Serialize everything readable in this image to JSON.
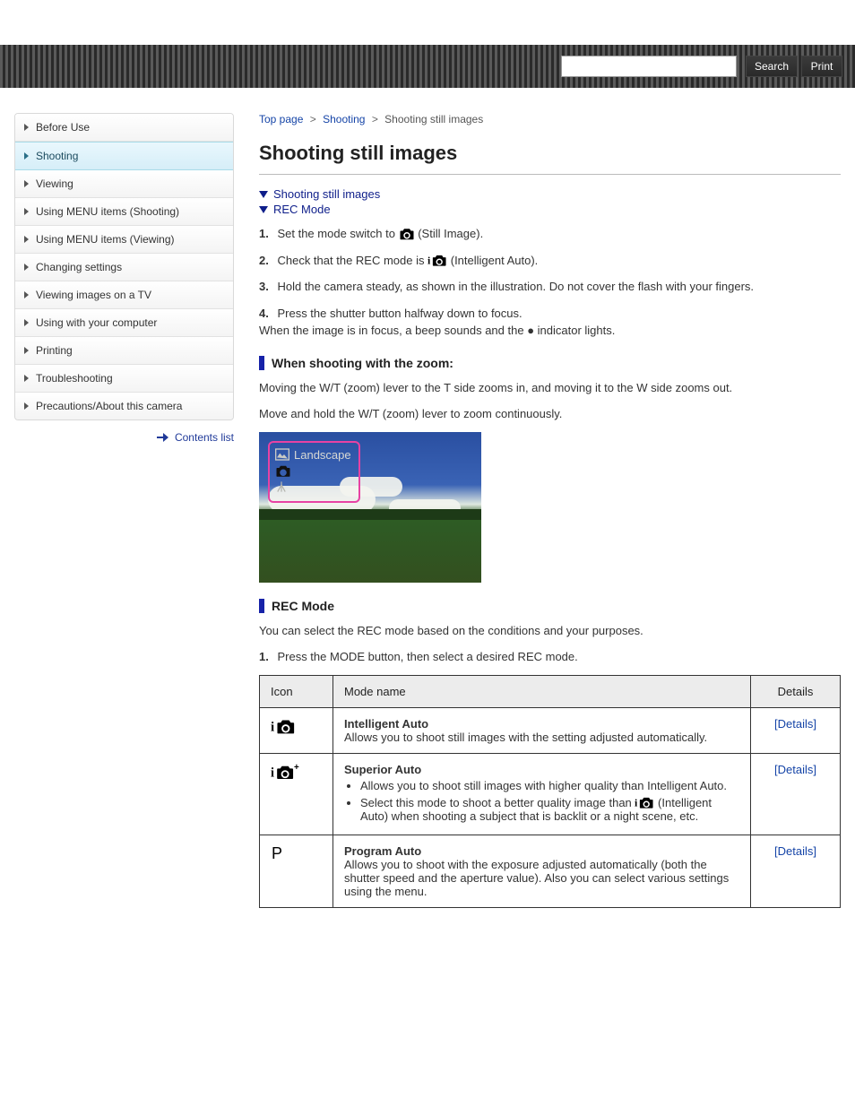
{
  "header": {
    "search_placeholder": "",
    "search_button": "Search",
    "print_button": "Print"
  },
  "sidebar": {
    "items": [
      {
        "label": "Before Use"
      },
      {
        "label": "Shooting"
      },
      {
        "label": "Viewing"
      },
      {
        "label": "Using MENU items (Shooting)"
      },
      {
        "label": "Using MENU items (Viewing)"
      },
      {
        "label": "Changing settings"
      },
      {
        "label": "Viewing images on a TV"
      },
      {
        "label": "Using with your computer"
      },
      {
        "label": "Printing"
      },
      {
        "label": "Troubleshooting"
      },
      {
        "label": "Precautions/About this camera"
      }
    ],
    "active_index": 1,
    "toppage": "Contents list"
  },
  "breadcrumb": {
    "a": "Top page",
    "b": "Shooting",
    "current": "Shooting still images"
  },
  "title": "Shooting still images",
  "disclosures": {
    "d1": "Shooting still images",
    "d2": "REC Mode"
  },
  "block1": {
    "step1_num": "1.",
    "step1_a": "Set the mode switch to ",
    "step1_b": " (Still Image).",
    "step2_num": "2.",
    "step2_a": "Check that the REC mode is ",
    "step2_b": " (Intelligent Auto).",
    "step3_num": "3.",
    "step3": "Hold the camera steady, as shown in the illustration. Do not cover the flash with your fingers.",
    "step4_num": "4.",
    "step4_a": "Press the shutter button halfway down to focus.",
    "step4_b": "When the image is in focus, a beep sounds and the ● indicator lights."
  },
  "overlay_label": "Landscape",
  "section_head1": "When shooting with the zoom:",
  "block2": {
    "p1": "Moving the W/T (zoom) lever to the T side zooms in, and moving it to the W side zooms out.",
    "p2": "Move and hold the W/T (zoom) lever to zoom continuously."
  },
  "section_head2": "REC Mode",
  "rec_mode_intro": "You can select the REC mode based on the conditions and your purposes.",
  "rec_mode_step_num": "1.",
  "rec_mode_step": "Press the MODE button, then select a desired REC mode.",
  "table": {
    "h_icon": "Icon",
    "h_name": "Mode name",
    "h_details": "Details",
    "rows": [
      {
        "mode": "intelligent-auto",
        "name": "Intelligent Auto",
        "desc": "Allows you to shoot still images with the setting adjusted automatically.",
        "details": "[Details]"
      },
      {
        "mode": "superior-auto",
        "name": "Superior Auto",
        "bullets": [
          "Allows you to shoot still images with higher quality than Intelligent Auto.",
          {
            "pre": "Select this mode to shoot a better quality image than ",
            "post": " (Intelligent Auto) when shooting a subject that is backlit or a night scene, etc."
          }
        ],
        "details": "[Details]"
      },
      {
        "mode": "program-auto",
        "name": "Program Auto",
        "desc": "Allows you to shoot with the exposure adjusted automatically (both the shutter speed and the aperture value). Also you can select various settings using the menu.",
        "details": "[Details]"
      }
    ]
  }
}
